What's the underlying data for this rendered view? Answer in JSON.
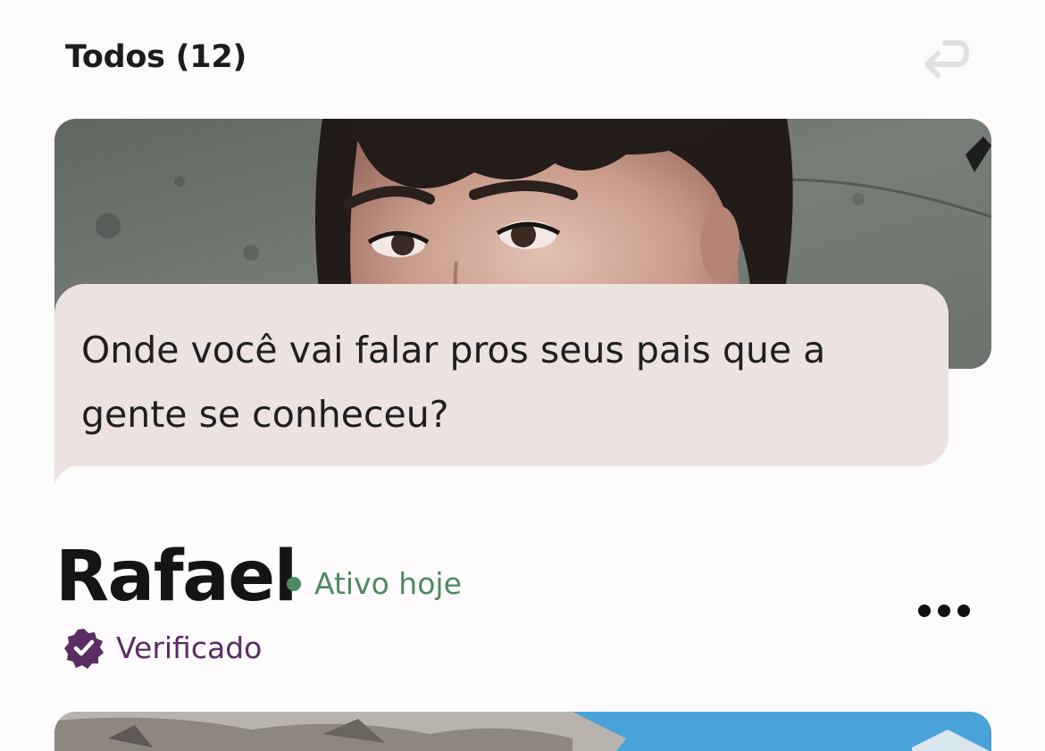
{
  "header": {
    "title": "Todos (12)",
    "undo_icon": "undo-arrow-icon"
  },
  "prompt": {
    "text": "Onde você vai falar pros seus pais que a gente se conheceu?"
  },
  "profile": {
    "name": "Rafael",
    "status": "Ativo hoje",
    "verified_label": "Verificado",
    "more_icon": "more-horizontal-icon",
    "verified_icon": "verified-badge-icon"
  },
  "colors": {
    "background": "#fdfbfb",
    "bubble": "#ece2e0",
    "active_green": "#4d8a63",
    "verified_purple": "#5a2d63",
    "disabled_icon": "#e4e0df"
  }
}
